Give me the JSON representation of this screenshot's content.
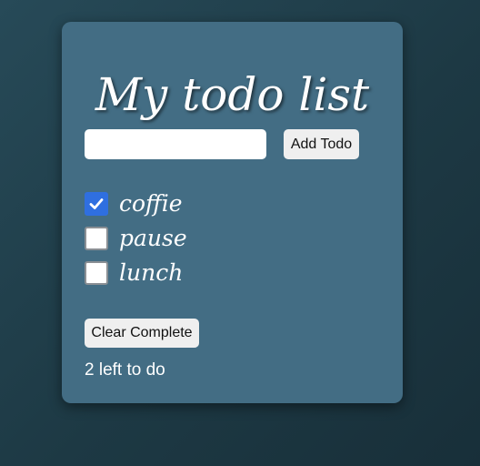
{
  "app": {
    "title": "My todo list"
  },
  "form": {
    "input_value": "",
    "input_placeholder": "",
    "add_label": "Add Todo"
  },
  "todos": [
    {
      "text": "coffie",
      "done": true
    },
    {
      "text": "pause",
      "done": false
    },
    {
      "text": "lunch",
      "done": false
    }
  ],
  "footer": {
    "clear_label": "Clear Complete",
    "remaining_text": "2 left to do"
  },
  "colors": {
    "background": "#1f3b47",
    "card": "#436d84",
    "checkbox_checked": "#2f6fe0",
    "button": "#efefef",
    "text": "#ffffff"
  },
  "icons": {
    "checked": "check-icon"
  }
}
